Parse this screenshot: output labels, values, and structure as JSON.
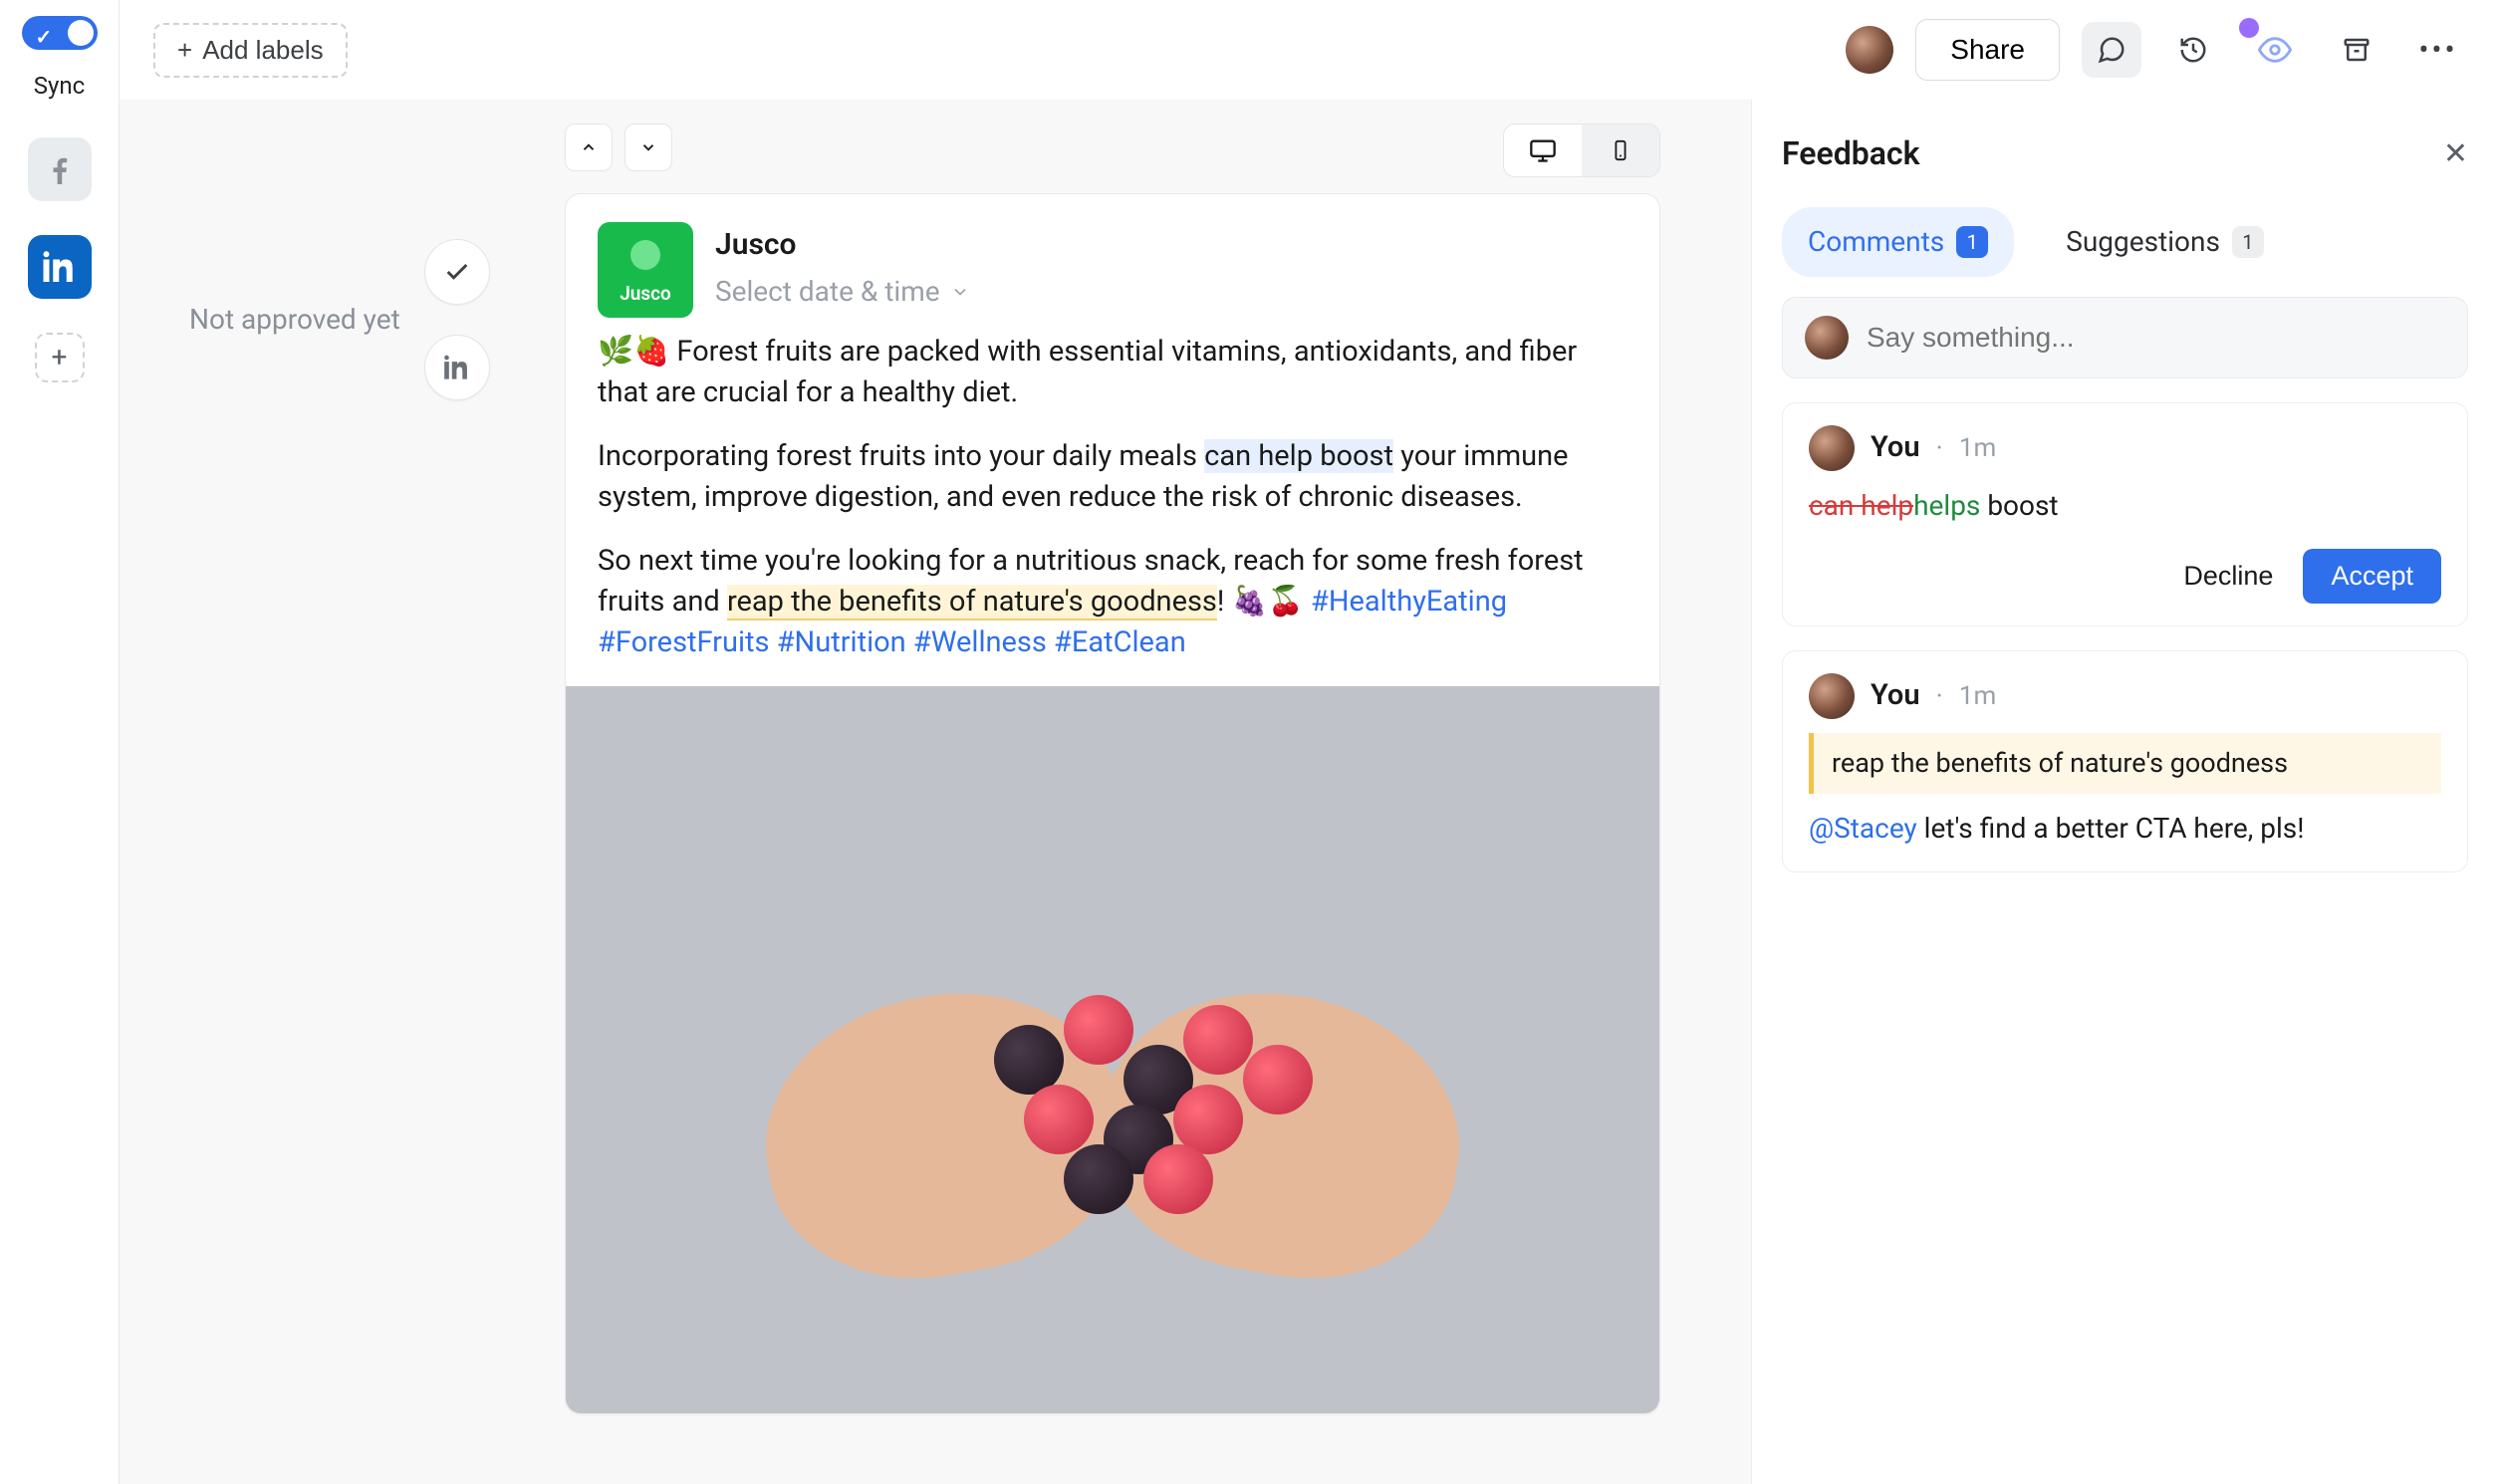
{
  "leftrail": {
    "sync_label": "Sync"
  },
  "topbar": {
    "add_labels": "Add labels",
    "share": "Share"
  },
  "status": {
    "approval": "Not approved yet"
  },
  "card": {
    "brand": "Jusco",
    "brand_word": "Jusco",
    "date_placeholder": "Select date & time",
    "p1_pre": "🌿🍓 Forest fruits are packed with essential vitamins, antioxidants, and fiber that are crucial for a healthy diet.",
    "p2_pre": "Incorporating forest fruits into your daily meals ",
    "p2_hl": "can help boost",
    "p2_post": " your immune system, improve digestion, and even reduce the risk of chronic diseases.",
    "p3_pre": "So next time you're looking for a nutritious snack, reach for some fresh forest fruits and ",
    "p3_hl": "reap the benefits of nature's goodness",
    "p3_post": "! 🍇🍒 ",
    "tags": "#HealthyEating #ForestFruits #Nutrition #Wellness #EatClean"
  },
  "panel": {
    "title": "Feedback",
    "tabs": {
      "comments_label": "Comments",
      "comments_count": "1",
      "suggestions_label": "Suggestions",
      "suggestions_count": "1"
    },
    "say_placeholder": "Say something...",
    "item1": {
      "who": "You",
      "when": "1m",
      "del": "can help",
      "ins": "helps",
      "rest": " boost",
      "decline": "Decline",
      "accept": "Accept"
    },
    "item2": {
      "who": "You",
      "when": "1m",
      "quote": "reap the benefits of nature's goodness",
      "mention": "@Stacey",
      "text": " let's find a better CTA here, pls!"
    }
  }
}
